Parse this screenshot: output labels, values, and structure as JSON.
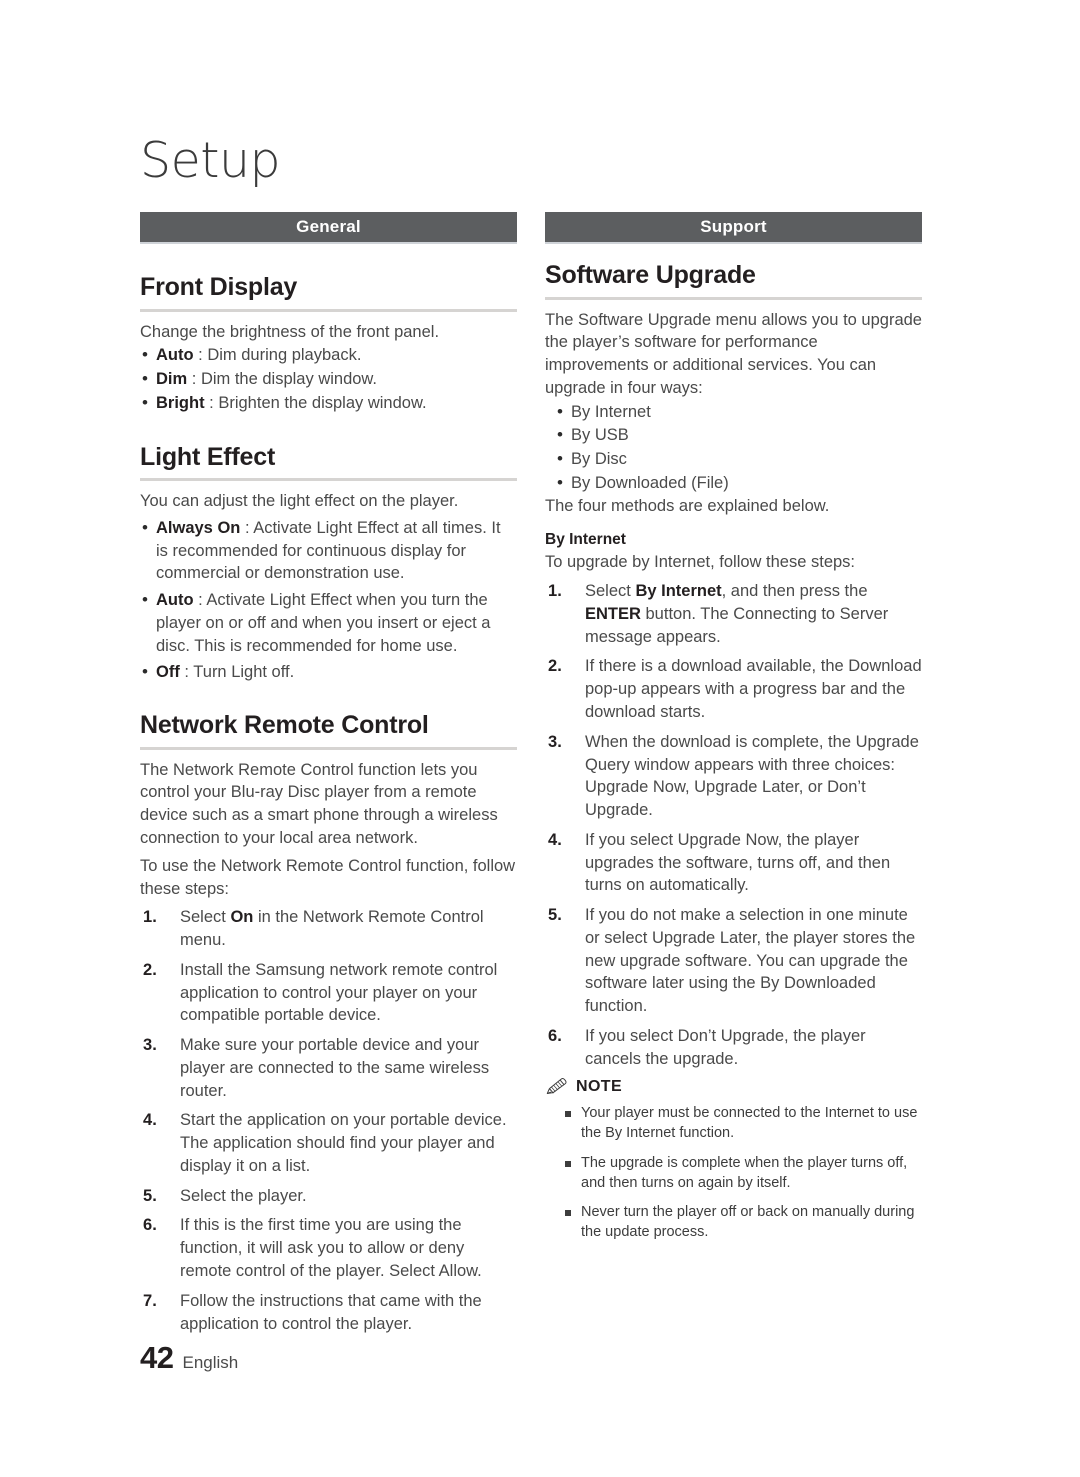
{
  "chapter": {
    "title": "Setup"
  },
  "footer": {
    "page_number": "42",
    "language": "English"
  },
  "columns": {
    "left": {
      "group_bar": {
        "label": "General",
        "color": "#5c5e60"
      },
      "sections": [
        {
          "title": "Front Display",
          "intro": "Change the brightness of the front panel.",
          "bullets": [
            {
              "term": "Auto",
              "sep": " : ",
              "text": "Dim during playback."
            },
            {
              "term": "Dim",
              "sep": " : ",
              "text": "Dim the display window."
            },
            {
              "term": "Bright",
              "sep": " : ",
              "text": "Brighten the display window."
            }
          ]
        },
        {
          "title": "Light Effect",
          "intro": "You can adjust the light effect on the player.",
          "bullets": [
            {
              "term": "Always On",
              "sep": " : ",
              "text": "Activate Light Effect at all times. It is recommended for continuous display for commercial or demonstration use."
            },
            {
              "term": "Auto",
              "sep": " : ",
              "text": "Activate Light Effect when you turn the player on or off and when you insert or eject a disc. This is recommended for home use."
            },
            {
              "term": "Off",
              "sep": " : ",
              "text": "Turn Light off."
            }
          ]
        },
        {
          "title": "Network Remote Control",
          "paragraph1": "The Network Remote Control function lets you control your Blu-ray Disc player from a remote device such as a smart phone through a wireless connection to your local area network.",
          "paragraph2": "To use the Network Remote Control function, follow these steps:",
          "steps": [
            {
              "pre": "Select ",
              "bold": "On",
              "post": " in the Network Remote Control menu."
            },
            {
              "pre": "Install the Samsung network remote control application to control your player on your compatible portable device.",
              "bold": "",
              "post": ""
            },
            {
              "pre": "Make sure your portable device and your player are connected to the same wireless router.",
              "bold": "",
              "post": ""
            },
            {
              "pre": "Start the application on your portable device. The application should find your player and display it on a list.",
              "bold": "",
              "post": ""
            },
            {
              "pre": "Select the player.",
              "bold": "",
              "post": ""
            },
            {
              "pre": "If this is the first time you are using the function, it will ask you to allow or deny remote control of the player. Select Allow.",
              "bold": "",
              "post": ""
            },
            {
              "pre": "Follow the instructions that came with the application to control the player.",
              "bold": "",
              "post": ""
            }
          ]
        }
      ]
    },
    "right": {
      "group_bar": {
        "label": "Support",
        "color": "#5c5e60"
      },
      "sections": [
        {
          "title": "Software Upgrade",
          "intro": "The Software Upgrade menu allows you to upgrade the player’s software for performance improvements or additional services. You can upgrade in four ways:",
          "methods": [
            "By Internet",
            "By USB",
            "By Disc",
            "By Downloaded (File)"
          ],
          "outro": "The four methods are explained below.",
          "sub_title": "By Internet",
          "sub_intro": "To upgrade by Internet, follow these steps:",
          "steps": [
            {
              "pre": "Select ",
              "bold": "By Internet",
              "mid": ", and then press the ",
              "bold2": "ENTER",
              "post": " button. The Connecting to Server message appears."
            },
            {
              "pre": "If there is a download available, the Download pop-up appears with a progress bar and the download starts.",
              "bold": "",
              "mid": "",
              "bold2": "",
              "post": ""
            },
            {
              "pre": "When the download is complete, the Upgrade Query window appears with three choices: Upgrade Now, Upgrade Later, or Don’t Upgrade.",
              "bold": "",
              "mid": "",
              "bold2": "",
              "post": ""
            },
            {
              "pre": "If you select Upgrade Now, the player upgrades the software, turns off, and then turns on automatically.",
              "bold": "",
              "mid": "",
              "bold2": "",
              "post": ""
            },
            {
              "pre": "If you do not make a selection in one minute or select Upgrade Later, the player stores the new upgrade software. You can upgrade the software later using the By Downloaded function.",
              "bold": "",
              "mid": "",
              "bold2": "",
              "post": ""
            },
            {
              "pre": "If you select Don’t Upgrade, the player cancels the upgrade.",
              "bold": "",
              "mid": "",
              "bold2": "",
              "post": ""
            }
          ],
          "note": {
            "label": "NOTE",
            "icon": "pencil-icon",
            "items": [
              "Your player must be connected to the Internet to use the By Internet function.",
              "The upgrade is complete when the player turns off, and then turns on again by itself.",
              "Never turn the player off or back on manually during the update process."
            ]
          }
        }
      ]
    }
  }
}
